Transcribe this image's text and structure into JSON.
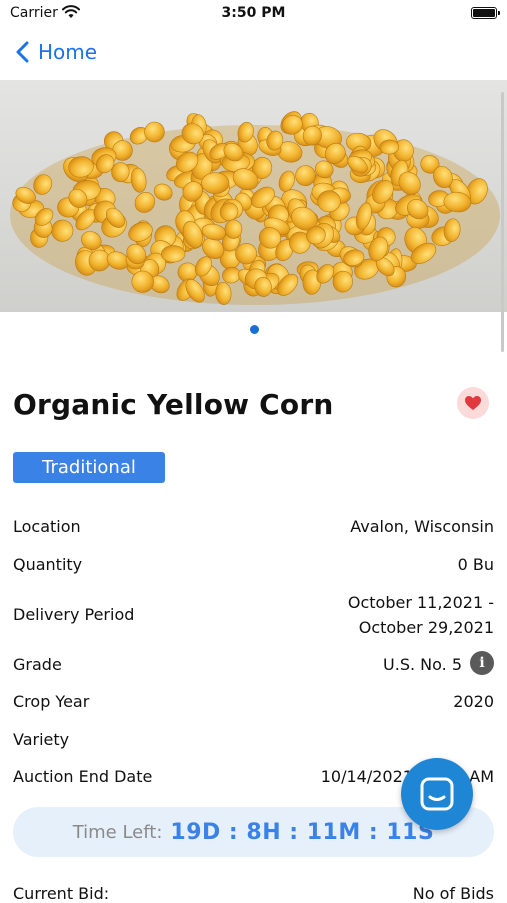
{
  "status_bar": {
    "carrier": "Carrier",
    "time": "3:50 PM"
  },
  "nav": {
    "back_label": "Home"
  },
  "product": {
    "title": "Organic Yellow Corn",
    "badge": "Traditional"
  },
  "details": {
    "location_label": "Location",
    "location_value": "Avalon, Wisconsin",
    "quantity_label": "Quantity",
    "quantity_value": "0 Bu",
    "delivery_label": "Delivery Period",
    "delivery_line1": "October 11,2021 -",
    "delivery_line2": "October 29,2021",
    "grade_label": "Grade",
    "grade_value": "U.S. No. 5",
    "info_glyph": "i",
    "crop_year_label": "Crop Year",
    "crop_year_value": "2020",
    "variety_label": "Variety",
    "auction_end_label": "Auction End Date",
    "auction_end_value": "10/14/2021 11:00 AM"
  },
  "timer": {
    "label": "Time Left:",
    "value": "19D : 8H : 11M : 11S"
  },
  "bids": {
    "current_bid_label": "Current Bid:",
    "bids_label": "No of Bids"
  },
  "colors": {
    "accent": "#3b82e6",
    "fab": "#1f86d6",
    "heart": "#e0393e"
  },
  "icons": {
    "back": "chevron-left-icon",
    "favorite": "heart-icon",
    "info": "info-icon",
    "chat": "chat-icon"
  }
}
